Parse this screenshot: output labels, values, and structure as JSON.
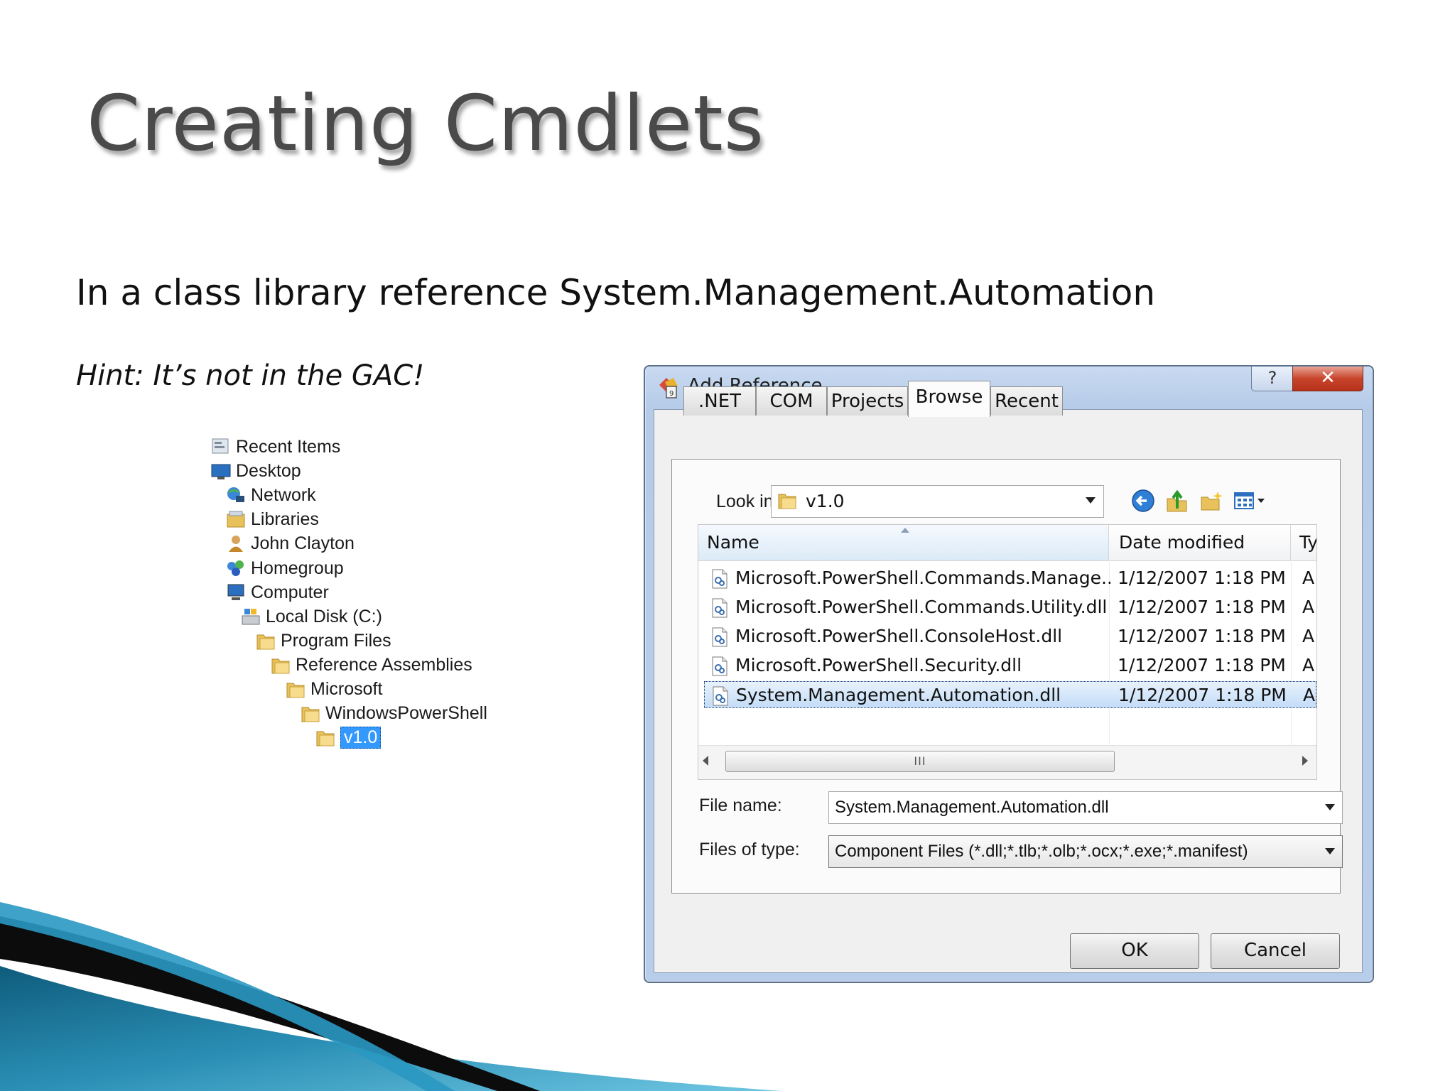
{
  "slide": {
    "title": "Creating Cmdlets",
    "subtitle": "In a class library reference System.Management.Automation",
    "hint": "Hint: It’s not in the GAC!"
  },
  "tree": {
    "items": [
      {
        "label": "Recent Items",
        "icon": "recent-items-icon"
      },
      {
        "label": "Desktop",
        "icon": "desktop-icon"
      },
      {
        "label": "Network",
        "icon": "network-icon"
      },
      {
        "label": "Libraries",
        "icon": "libraries-icon"
      },
      {
        "label": "John Clayton",
        "icon": "user-icon"
      },
      {
        "label": "Homegroup",
        "icon": "homegroup-icon"
      },
      {
        "label": "Computer",
        "icon": "computer-icon"
      },
      {
        "label": "Local Disk (C:)",
        "icon": "disk-icon"
      },
      {
        "label": "Program Files",
        "icon": "folder-icon"
      },
      {
        "label": "Reference Assemblies",
        "icon": "folder-icon"
      },
      {
        "label": "Microsoft",
        "icon": "folder-icon"
      },
      {
        "label": "WindowsPowerShell",
        "icon": "folder-icon"
      },
      {
        "label": "v1.0",
        "icon": "folder-icon",
        "selected": true
      }
    ]
  },
  "dialog": {
    "title": "Add Reference",
    "help_label": "?",
    "close_label": "✕",
    "tabs": [
      {
        "label": ".NET"
      },
      {
        "label": "COM"
      },
      {
        "label": "Projects"
      },
      {
        "label": "Browse",
        "active": true
      },
      {
        "label": "Recent"
      }
    ],
    "look_in_label": "Look in:",
    "look_in_value": "v1.0",
    "columns": {
      "name": "Name",
      "date": "Date modified",
      "type": "Ty"
    },
    "files": [
      {
        "name": "Microsoft.PowerShell.Commands.Manage...",
        "date": "1/12/2007 1:18 PM",
        "type": "A"
      },
      {
        "name": "Microsoft.PowerShell.Commands.Utility.dll",
        "date": "1/12/2007 1:18 PM",
        "type": "A"
      },
      {
        "name": "Microsoft.PowerShell.ConsoleHost.dll",
        "date": "1/12/2007 1:18 PM",
        "type": "A"
      },
      {
        "name": "Microsoft.PowerShell.Security.dll",
        "date": "1/12/2007 1:18 PM",
        "type": "A"
      },
      {
        "name": "System.Management.Automation.dll",
        "date": "1/12/2007 1:18 PM",
        "type": "A",
        "selected": true
      }
    ],
    "scroll_grip": "III",
    "file_name_label": "File name:",
    "file_name_value": "System.Management.Automation.dll",
    "files_of_type_label": "Files of type:",
    "files_of_type_value": "Component Files (*.dll;*.tlb;*.olb;*.ocx;*.exe;*.manifest)",
    "ok_label": "OK",
    "cancel_label": "Cancel"
  },
  "colors": {
    "selection": "#3399ff",
    "dialog_frame": "#b5cbe8",
    "close_button": "#c8442b",
    "swoosh_blue": "#2a8fb5"
  }
}
